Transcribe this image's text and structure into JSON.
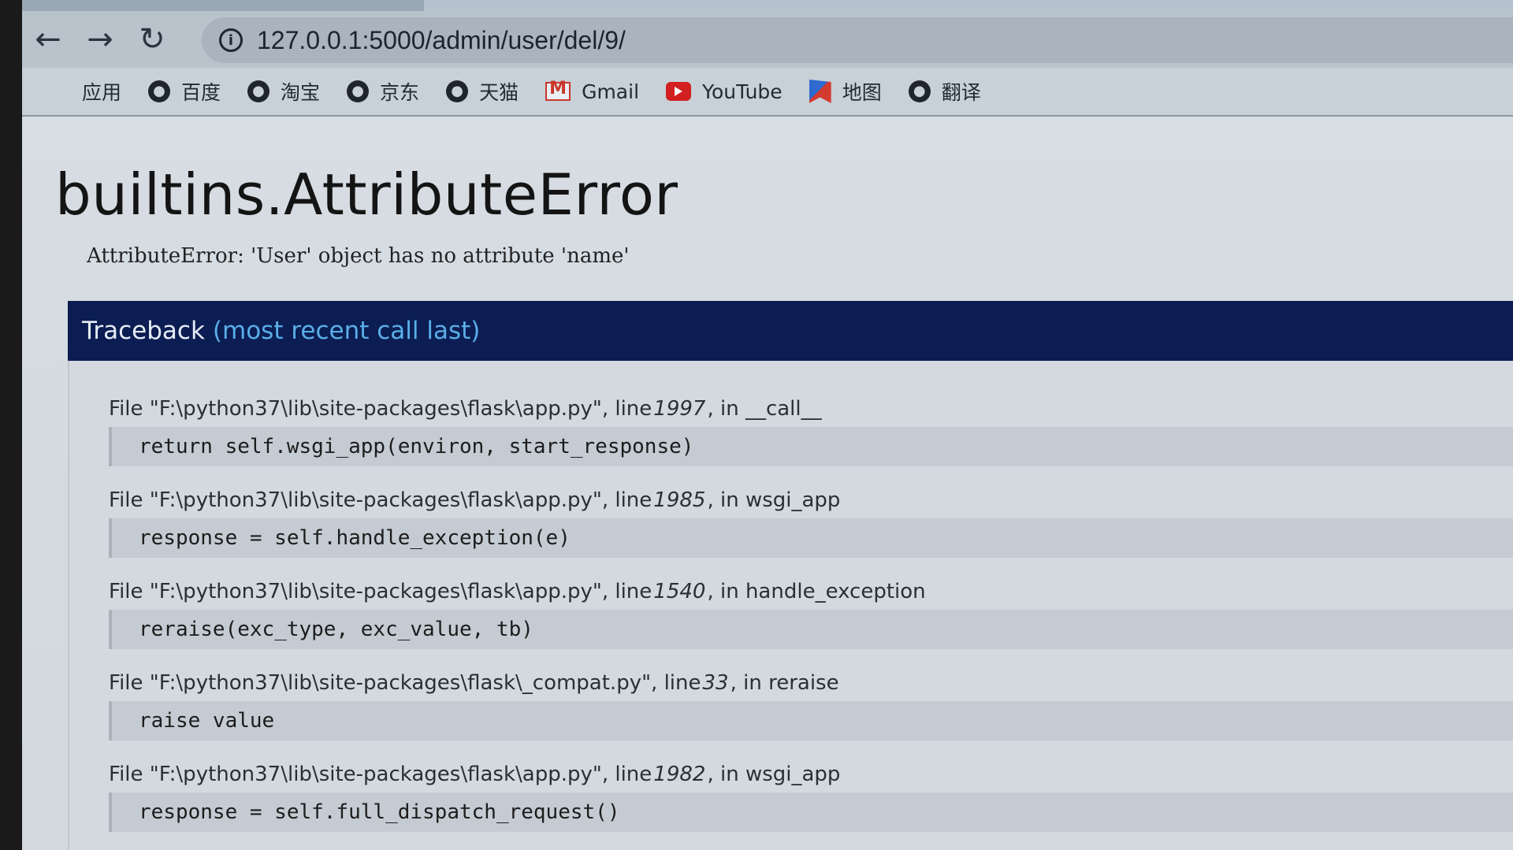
{
  "browser": {
    "url": "127.0.0.1:5000/admin/user/del/9/",
    "nav": {
      "back_icon": "back-arrow-icon",
      "forward_icon": "forward-arrow-icon",
      "reload_icon": "reload-icon"
    },
    "bookmarks": [
      {
        "label": "应用",
        "icon": "apps-grid-icon"
      },
      {
        "label": "百度",
        "icon": "globe-icon"
      },
      {
        "label": "淘宝",
        "icon": "globe-icon"
      },
      {
        "label": "京东",
        "icon": "globe-icon"
      },
      {
        "label": "天猫",
        "icon": "globe-icon"
      },
      {
        "label": "Gmail",
        "icon": "gmail-icon"
      },
      {
        "label": "YouTube",
        "icon": "youtube-icon"
      },
      {
        "label": "地图",
        "icon": "maps-icon"
      },
      {
        "label": "翻译",
        "icon": "globe-icon"
      }
    ]
  },
  "error": {
    "title": "builtins.AttributeError",
    "message": "AttributeError: 'User' object has no attribute 'name'"
  },
  "traceback": {
    "heading": "Traceback",
    "subheading": "(most recent call last)",
    "frames": [
      {
        "file_prefix": "File \"F:\\python37\\lib\\site-packages\\flask\\app.py\", line ",
        "line": "1997",
        "func_suffix": ", in __call__",
        "code": "return self.wsgi_app(environ, start_response)"
      },
      {
        "file_prefix": "File \"F:\\python37\\lib\\site-packages\\flask\\app.py\", line ",
        "line": "1985",
        "func_suffix": ", in wsgi_app",
        "code": "response = self.handle_exception(e)"
      },
      {
        "file_prefix": "File \"F:\\python37\\lib\\site-packages\\flask\\app.py\", line ",
        "line": "1540",
        "func_suffix": ", in handle_exception",
        "code": "reraise(exc_type, exc_value, tb)"
      },
      {
        "file_prefix": "File \"F:\\python37\\lib\\site-packages\\flask\\_compat.py\", line ",
        "line": "33",
        "func_suffix": ", in reraise",
        "code": "raise value"
      },
      {
        "file_prefix": "File \"F:\\python37\\lib\\site-packages\\flask\\app.py\", line ",
        "line": "1982",
        "func_suffix": ", in wsgi_app",
        "code": "response = self.full_dispatch_request()"
      }
    ]
  },
  "colors": {
    "traceback_header_bg": "#0b1d52",
    "traceback_header_text": "#e6ecf5",
    "traceback_header_accent": "#5aaee8"
  }
}
